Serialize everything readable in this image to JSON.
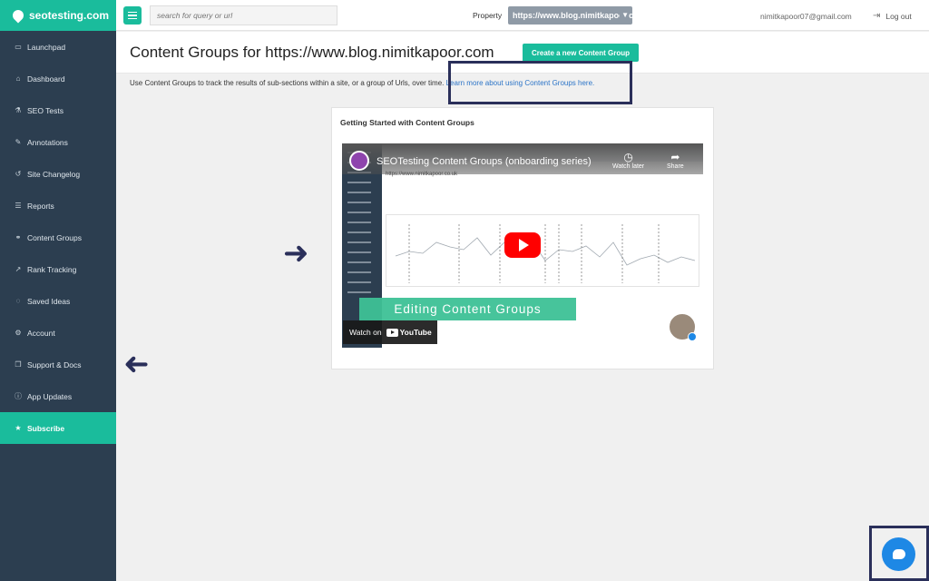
{
  "brand": {
    "name": "seotesting.com"
  },
  "sidebar": {
    "items": [
      {
        "label": "Launchpad",
        "icon": "monitor-icon",
        "glyph": "▭"
      },
      {
        "label": "Dashboard",
        "icon": "home-icon",
        "glyph": "⌂"
      },
      {
        "label": "SEO Tests",
        "icon": "flask-icon",
        "glyph": "⚗"
      },
      {
        "label": "Annotations",
        "icon": "pencil-icon",
        "glyph": "✎"
      },
      {
        "label": "Site Changelog",
        "icon": "history-icon",
        "glyph": "↺"
      },
      {
        "label": "Reports",
        "icon": "list-icon",
        "glyph": "☰"
      },
      {
        "label": "Content Groups",
        "icon": "groups-icon",
        "glyph": "⚭"
      },
      {
        "label": "Rank Tracking",
        "icon": "line-chart-icon",
        "glyph": "↗"
      },
      {
        "label": "Saved Ideas",
        "icon": "lightbulb-icon",
        "glyph": "◌"
      },
      {
        "label": "Account",
        "icon": "gear-icon",
        "glyph": "⚙"
      },
      {
        "label": "Support & Docs",
        "icon": "book-icon",
        "glyph": "❒"
      },
      {
        "label": "App Updates",
        "icon": "info-icon",
        "glyph": "ⓘ"
      },
      {
        "label": "Subscribe",
        "icon": "star-icon",
        "glyph": "★"
      }
    ]
  },
  "header": {
    "search_placeholder": "search for query or url",
    "property_label": "Property",
    "property_value": "https://www.blog.nimitkapoor.com",
    "email": "nimitkapoor07@gmail.com",
    "logout_label": "Log out"
  },
  "page": {
    "title": "Content Groups for https://www.blog.nimitkapoor.com",
    "create_button": "Create a new Content Group",
    "description": "Use Content Groups to track the results of sub-sections within a site, or a group of Urls, over time.",
    "learn_more_link": "Learn more about using Content Groups here."
  },
  "card": {
    "title": "Getting Started with Content Groups",
    "video": {
      "title": "SEOTesting Content Groups (onboarding series)",
      "watch_later": "Watch later",
      "share": "Share",
      "url_text": "https://www.nimitkapoor.co.uk",
      "banner": "Editing Content Groups",
      "watch_on": "Watch on",
      "youtube": "YouTube"
    }
  },
  "colors": {
    "accent": "#1abc9c",
    "sidebar": "#2c3e50",
    "annotation": "#2a2f5a",
    "chat": "#1e88e5"
  }
}
